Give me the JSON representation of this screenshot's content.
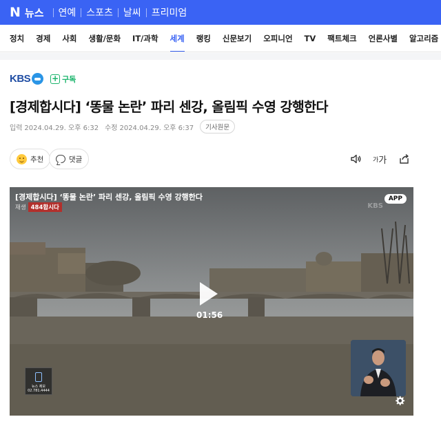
{
  "header": {
    "brand_letter": "N",
    "brand_label": "뉴스",
    "links": [
      "연예",
      "스포츠",
      "날씨",
      "프리미엄"
    ]
  },
  "nav": {
    "items": [
      "정치",
      "경제",
      "사회",
      "생활/문화",
      "IT/과학",
      "세계",
      "랭킹",
      "신문보기",
      "오피니언",
      "TV",
      "팩트체크",
      "언론사별",
      "알고리즘 안내"
    ],
    "active": "세계"
  },
  "press": {
    "name": "KBS",
    "subscribe_label": "구독"
  },
  "article": {
    "headline": "[경제합시다] ‘똥물 논란’ 파리 센강, 올림픽 수영 강행한다",
    "input_label": "입력",
    "input_time": "2024.04.29. 오후 6:32",
    "modified_label": "수정",
    "modified_time": "2024.04.29. 오후 6:37",
    "original_label": "기사원문"
  },
  "actions": {
    "recommend_label": "추천",
    "comment_label": "댓글",
    "fontsize_label": "가"
  },
  "video": {
    "title": "[경제합시다] ‘똥물 논란’ 파리 센강, 올림픽 수영 강행한다",
    "overlay_prefix": "재생",
    "overlay_badge": "484합시다",
    "watermark": "KBS",
    "app_badge": "APP",
    "duration": "01:56",
    "news_chip_line1": "뉴스 제보",
    "news_chip_line2": "02.781.4444"
  },
  "colors": {
    "brand_blue": "#3a63f4",
    "subscribe_green": "#19b46b"
  }
}
